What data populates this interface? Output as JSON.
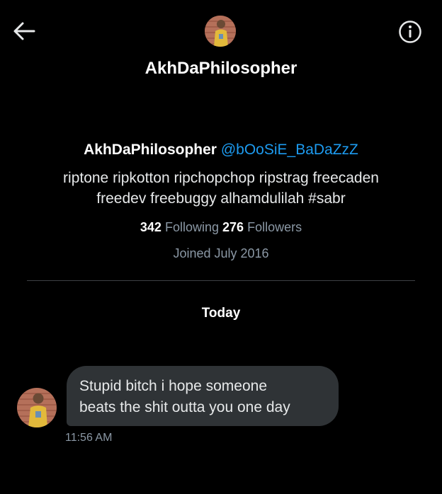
{
  "header": {
    "title": "AkhDaPhilosopher",
    "back_icon": "arrow-left-icon",
    "info_icon": "info-icon"
  },
  "profile": {
    "name": "AkhDaPhilosopher",
    "handle": "@bOoSiE_BaDaZzZ",
    "bio_line1": "riptone ripkotton ripchopchop ripstrag freecaden",
    "bio_line2": "freedev freebuggy alhamdulilah #sabr",
    "following_count": "342",
    "following_label": "Following",
    "followers_count": "276",
    "followers_label": "Followers",
    "joined": "Joined July 2016"
  },
  "conversation": {
    "date_separator": "Today",
    "messages": [
      {
        "line1": "Stupid bitch i hope someone",
        "line2": "beats the shit outta you one day",
        "time": "11:56 AM"
      }
    ]
  },
  "colors": {
    "background": "#000000",
    "handle": "#1d9bf0",
    "bubble": "#2f3336",
    "muted_text": "#8b98a5"
  }
}
